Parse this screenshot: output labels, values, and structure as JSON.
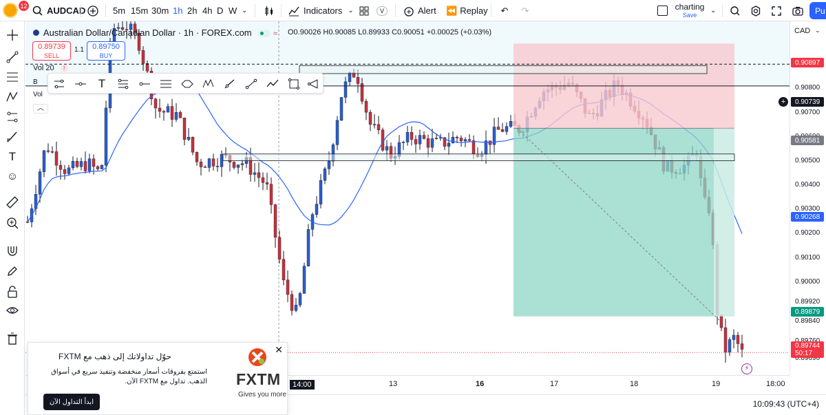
{
  "toolbar": {
    "notification_count": "12",
    "symbol": "AUDCAD",
    "intervals": [
      "5m",
      "15m",
      "30m",
      "1h",
      "2h",
      "4h",
      "D",
      "W"
    ],
    "active_interval": "1h",
    "indicators_label": "Indicators",
    "v_label": "V",
    "alert_label": "Alert",
    "replay_label": "Replay",
    "layout_name": "charting",
    "layout_sub": "Save",
    "publish_label": "Pu"
  },
  "legend": {
    "title": "Australian Dollar/Canadian Dollar · 1h · FOREX.com",
    "ohlc": "O0.90026 H0.90085 L0.89933 C0.90051 +0.00025 (+0.03%)",
    "sell_price": "0.89739",
    "sell_label": "SELL",
    "buy_price": "0.89750",
    "buy_label": "BUY",
    "spread": "1.1",
    "vol_label": "Vol 20",
    "vol_label2": "Vol",
    "b_label": "B"
  },
  "price_axis": {
    "currency": "CAD",
    "ticks": [
      "0.90800",
      "0.90700",
      "0.90600",
      "0.90500",
      "0.90400",
      "0.90300",
      "0.90200",
      "0.90100",
      "0.90000",
      "0.89920",
      "0.89840",
      "0.89760",
      "0.89690"
    ],
    "labels": [
      {
        "text": "0.90897",
        "color": "#f23645"
      },
      {
        "text": "0.90739",
        "color": "#131722"
      },
      {
        "text": "0.90581",
        "color": "#787b86"
      },
      {
        "text": "0.90268",
        "color": "#2962ff"
      },
      {
        "text": "0.89879",
        "color": "#089981"
      },
      {
        "text": "0.89744",
        "color": "#f23645"
      }
    ],
    "countdown": "50:17"
  },
  "time_axis": {
    "ticks": [
      "14:00",
      "13",
      "16",
      "17",
      "18",
      "19",
      "18:00"
    ]
  },
  "bottom": {
    "clock": "10:09:43 (UTC+4)"
  },
  "ad": {
    "title": "حوّل تداولاتك إلى ذهب مع FXTM",
    "body": "استمتع بفروقات أسعار منخفضة وتنفيذ سريع في أسواق الذهب. تداول مع FXTM الآن.",
    "button": "ابدأ التداول الآن",
    "brand": "FXTM",
    "tagline": "Gives you more"
  },
  "chart_data": {
    "type": "candlestick",
    "symbol": "AUDCAD",
    "interval": "1h",
    "ylim": [
      0.8966,
      0.9098
    ],
    "drawings": {
      "short_position": {
        "entry": 0.90581,
        "stop": 0.90897,
        "target": 0.89879
      },
      "resistance_zone": [
        0.90785,
        0.90815
      ],
      "support_zone": [
        0.9046,
        0.90485
      ],
      "horizontal_line": 0.90739,
      "dashed_level": 0.9082
    },
    "moving_average": "blue line"
  }
}
